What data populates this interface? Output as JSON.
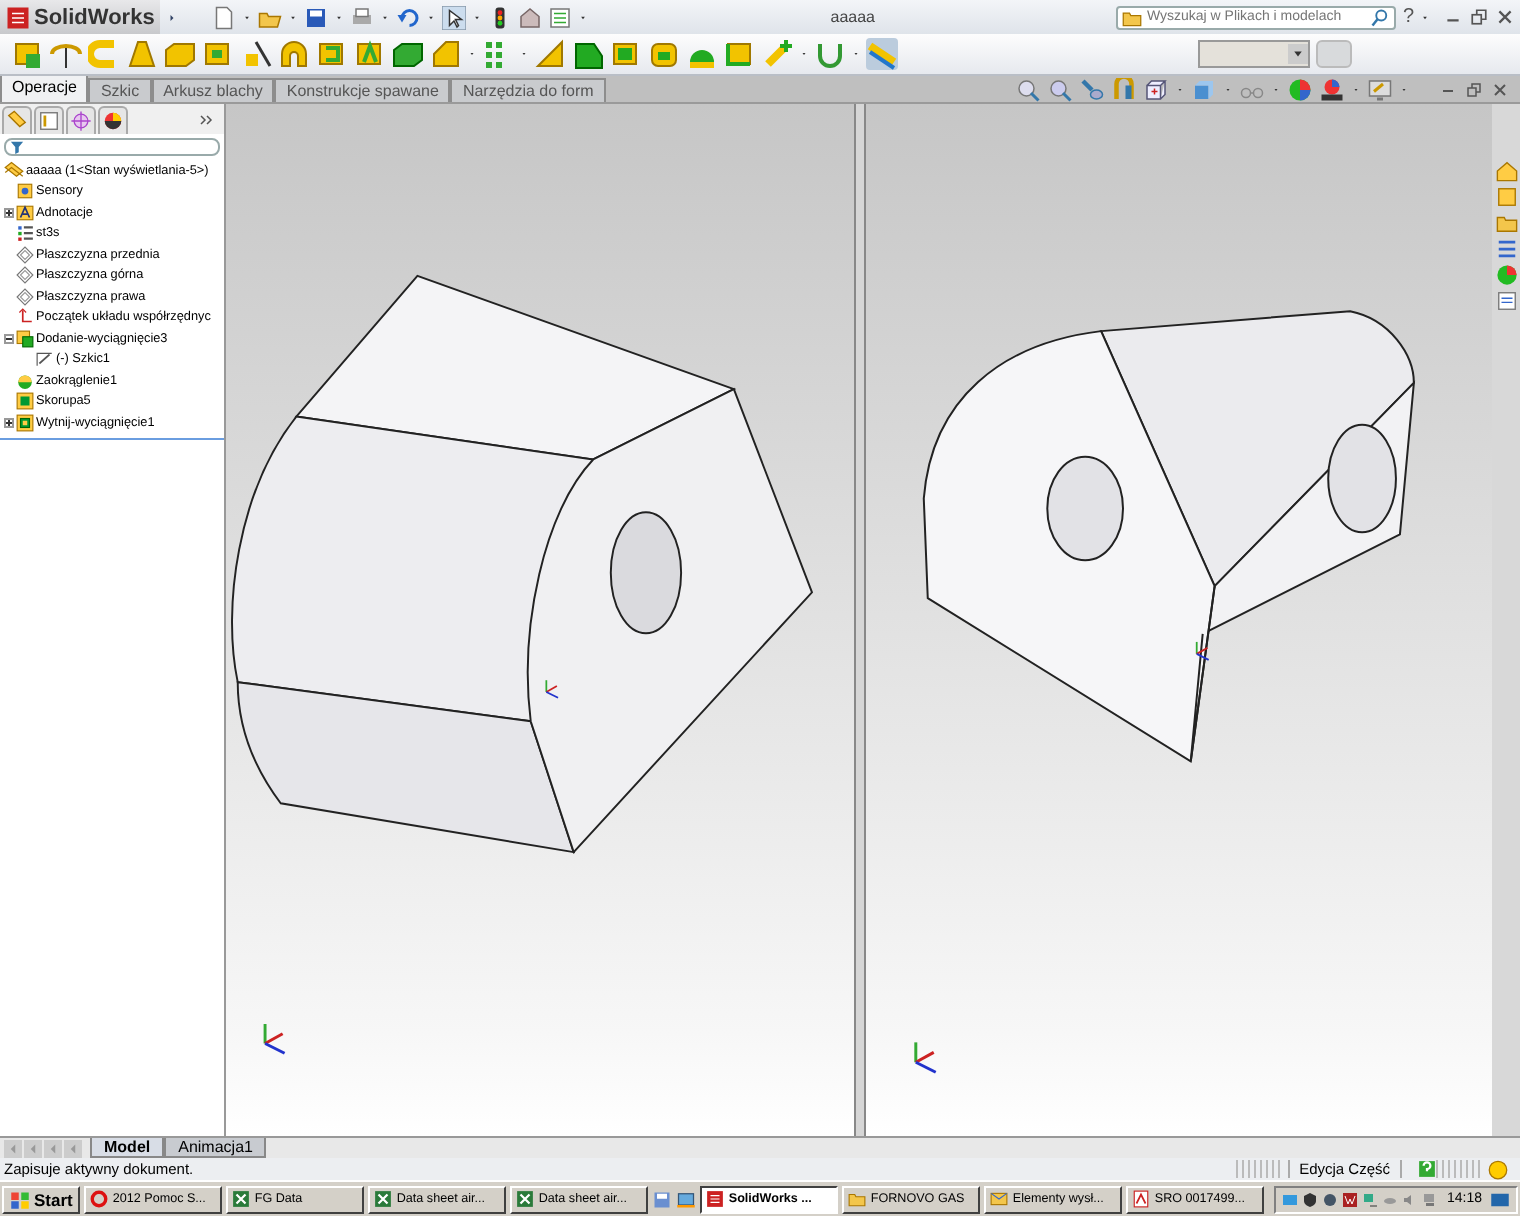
{
  "app": {
    "logo": "SolidWorks",
    "document_title": "aaaaa",
    "search": {
      "placeholder": "Wyszukaj w Plikach i modelach"
    },
    "help_glyph": "?"
  },
  "tabs": [
    {
      "label": "Operacje",
      "selected": true
    },
    {
      "label": "Szkic",
      "selected": false
    },
    {
      "label": "Arkusz blachy",
      "selected": false
    },
    {
      "label": "Konstrukcje spawane",
      "selected": false
    },
    {
      "label": "Narzędzia do form",
      "selected": false
    }
  ],
  "tree": {
    "root": "aaaaa  (1<Stan wyświetlania-5>)",
    "items": [
      {
        "label": "Sensory",
        "kind": "sensor"
      },
      {
        "label": "Adnotacje",
        "kind": "annotation",
        "expanded": false
      },
      {
        "label": "st3s",
        "kind": "material"
      },
      {
        "label": "Płaszczyzna przednia",
        "kind": "plane"
      },
      {
        "label": "Płaszczyzna górna",
        "kind": "plane"
      },
      {
        "label": "Płaszczyzna prawa",
        "kind": "plane"
      },
      {
        "label": "Początek układu współrzędnyc",
        "kind": "origin"
      },
      {
        "label": "Dodanie-wyciągnięcie3",
        "kind": "extrude",
        "expanded": true,
        "children": [
          {
            "label": "(-) Szkic1",
            "kind": "sketch"
          }
        ]
      },
      {
        "label": "Zaokrąglenie1",
        "kind": "fillet"
      },
      {
        "label": "Skorupa5",
        "kind": "shell"
      },
      {
        "label": "Wytnij-wyciągnięcie1",
        "kind": "cut",
        "expanded": false
      }
    ]
  },
  "bottom_tabs": [
    {
      "label": "Model",
      "selected": true
    },
    {
      "label": "Animacja1",
      "selected": false
    }
  ],
  "status_bar": {
    "message": "Zapisuje aktywny dokument.",
    "mode": "Edycja Część"
  },
  "taskbar": {
    "start": "Start",
    "items": [
      {
        "label": "2012 Pomoc S...",
        "kind": "opera",
        "selected": false
      },
      {
        "label": "FG Data",
        "kind": "excel",
        "selected": false
      },
      {
        "label": "Data sheet air...",
        "kind": "excel",
        "selected": false
      },
      {
        "label": "Data sheet air...",
        "kind": "excel",
        "selected": false
      },
      {
        "label": "SolidWorks ...",
        "kind": "solidworks",
        "selected": true
      },
      {
        "label": "FORNOVO GAS",
        "kind": "folder",
        "selected": false
      },
      {
        "label": "Elementy wysł...",
        "kind": "outlook",
        "selected": false
      },
      {
        "label": "SRO 0017499...",
        "kind": "pdf",
        "selected": false
      }
    ],
    "clock": "14:18"
  }
}
